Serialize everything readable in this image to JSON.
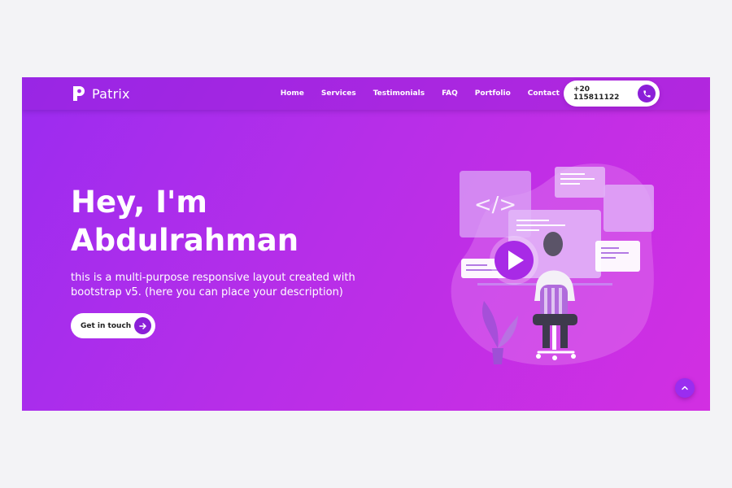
{
  "brand": {
    "name": "Patrix",
    "icon": "p-logo-icon"
  },
  "nav": {
    "links": [
      "Home",
      "Services",
      "Testimonials",
      "FAQ",
      "Portfolio",
      "Contact"
    ],
    "phone": "+20 115811122",
    "phone_icon": "phone-icon"
  },
  "hero": {
    "title_line1": "Hey, I'm",
    "title_line2": "Abdulrahman",
    "description": "this is a multi-purpose responsive layout created with bootstrap v5. (here you can place your description)",
    "cta_label": "Get in touch",
    "cta_icon": "arrow-right-icon"
  },
  "scroll_top_icon": "chevron-up-icon",
  "colors": {
    "gradient_start": "#9b2cf0",
    "gradient_end": "#d22fe2",
    "accent": "#8b1fd8",
    "page_bg": "#f3f3f6"
  }
}
